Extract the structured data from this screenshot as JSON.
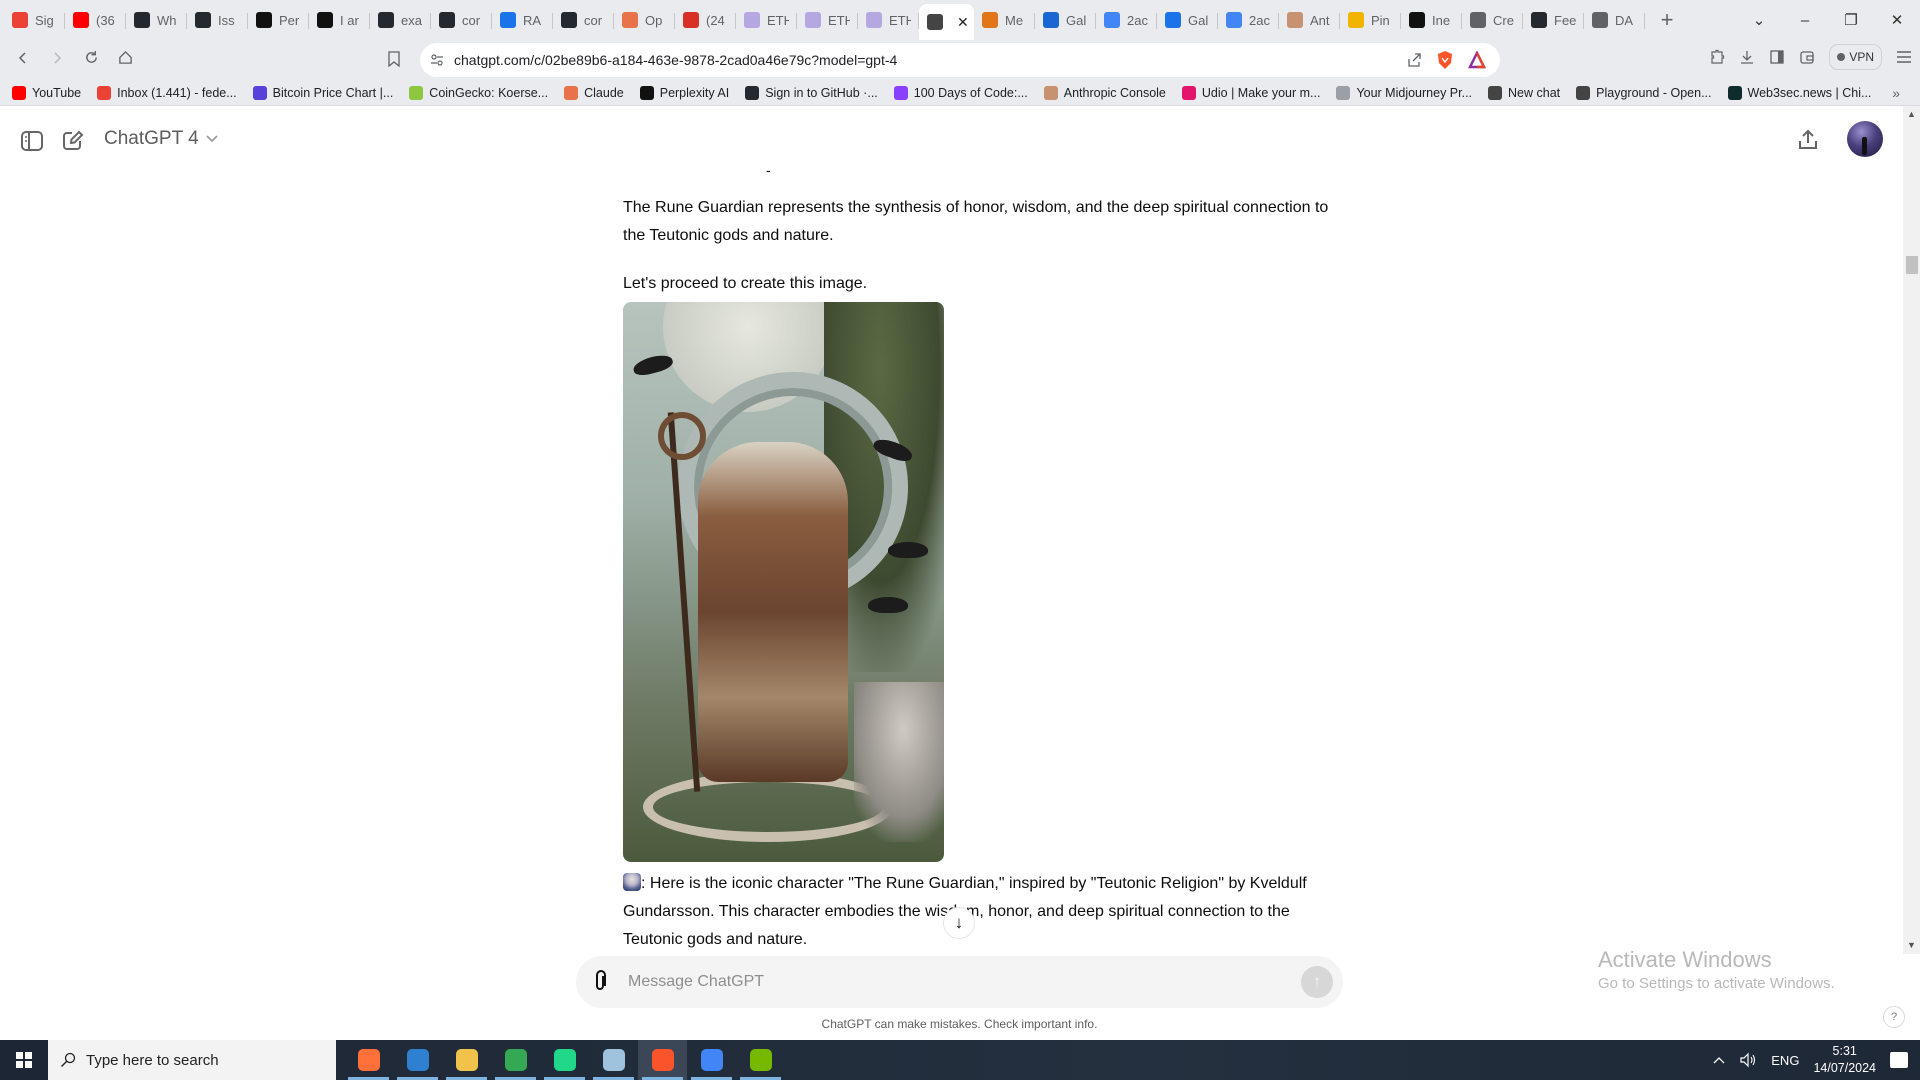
{
  "browser": {
    "tabs": [
      {
        "label": "Sig",
        "icon": "gmail-icon",
        "color": "#ea4335"
      },
      {
        "label": "(36",
        "icon": "youtube-icon",
        "color": "#ff0000"
      },
      {
        "label": "Wh",
        "icon": "github-icon",
        "color": "#24292f"
      },
      {
        "label": "Iss",
        "icon": "github-icon",
        "color": "#24292f"
      },
      {
        "label": "Per",
        "icon": "perplexity-icon",
        "color": "#111111"
      },
      {
        "label": "I ar",
        "icon": "perplexity-icon",
        "color": "#111111"
      },
      {
        "label": "exa",
        "icon": "github-icon",
        "color": "#24292f"
      },
      {
        "label": "cor",
        "icon": "github-icon",
        "color": "#24292f"
      },
      {
        "label": "RA",
        "icon": "blue-square-icon",
        "color": "#1a73e8"
      },
      {
        "label": "cor",
        "icon": "github-icon",
        "color": "#24292f"
      },
      {
        "label": "Op",
        "icon": "asterisk-icon",
        "color": "#e8734a"
      },
      {
        "label": "(24",
        "icon": "badge-2k-icon",
        "color": "#d93025"
      },
      {
        "label": "ETH",
        "icon": "eth-icon",
        "color": "#b5a7e0"
      },
      {
        "label": "ETH",
        "icon": "eth-icon",
        "color": "#b5a7e0"
      },
      {
        "label": "ETH",
        "icon": "eth-icon",
        "color": "#b5a7e0"
      },
      {
        "label": "",
        "icon": "openai-icon",
        "color": "#444444",
        "active": true,
        "close": "✕"
      },
      {
        "label": "Me",
        "icon": "metamask-icon",
        "color": "#e2761b"
      },
      {
        "label": "Gal",
        "icon": "download-square-icon",
        "color": "#1967d2"
      },
      {
        "label": "2ac",
        "icon": "hexagon-icon",
        "color": "#4285f4"
      },
      {
        "label": "Gal",
        "icon": "blue-square-icon",
        "color": "#1a73e8"
      },
      {
        "label": "2ac",
        "icon": "hexagon-icon",
        "color": "#4285f4"
      },
      {
        "label": "Ant",
        "icon": "anthropic-icon",
        "color": "#c69270"
      },
      {
        "label": "Pin",
        "icon": "pinata-icon",
        "color": "#f2b400"
      },
      {
        "label": "Ine",
        "icon": "perplexity-icon",
        "color": "#111111"
      },
      {
        "label": "Cre",
        "icon": "globe-icon",
        "color": "#5f6368"
      },
      {
        "label": "Fee",
        "icon": "github-icon",
        "color": "#24292f"
      },
      {
        "label": "DA",
        "icon": "globe-icon",
        "color": "#5f6368"
      }
    ],
    "new_tab": "+",
    "window_controls": {
      "tab_search": "⌄",
      "minimize": "–",
      "restore": "❐",
      "close": "✕"
    },
    "url": "chatgpt.com/c/02be89b6-a184-463e-9878-2cad0a46e79c?model=gpt-4",
    "vpn_label": "VPN",
    "bookmarks": [
      {
        "label": "YouTube",
        "icon": "youtube-icon",
        "color": "#ff0000"
      },
      {
        "label": "Inbox (1.441) - fede...",
        "icon": "gmail-icon",
        "color": "#ea4335"
      },
      {
        "label": "Bitcoin Price Chart |...",
        "icon": "kraken-icon",
        "color": "#5741d9"
      },
      {
        "label": "CoinGecko: Koerse...",
        "icon": "coingecko-icon",
        "color": "#8dc63f"
      },
      {
        "label": "Claude",
        "icon": "claude-icon",
        "color": "#e8734a"
      },
      {
        "label": "Perplexity AI",
        "icon": "perplexity-icon",
        "color": "#111111"
      },
      {
        "label": "Sign in to GitHub ·...",
        "icon": "github-icon",
        "color": "#24292f"
      },
      {
        "label": "100 Days of Code:...",
        "icon": "replit-icon",
        "color": "#8a3ffc"
      },
      {
        "label": "Anthropic Console",
        "icon": "anthropic-icon",
        "color": "#c69270"
      },
      {
        "label": "Udio | Make your m...",
        "icon": "udio-icon",
        "color": "#e2156b"
      },
      {
        "label": "Your Midjourney Pr...",
        "icon": "midjourney-icon",
        "color": "#9aa0a6"
      },
      {
        "label": "New chat",
        "icon": "openai-icon",
        "color": "#444444"
      },
      {
        "label": "Playground - Open...",
        "icon": "openai-icon",
        "color": "#444444"
      },
      {
        "label": "Web3sec.news | Chi...",
        "icon": "terminal-icon",
        "color": "#0f2b2b"
      }
    ],
    "bookmarks_more": "»"
  },
  "chat": {
    "model_name": "ChatGPT 4",
    "dash": "-",
    "paragraph_1": "The Rune Guardian represents the synthesis of honor, wisdom, and the deep spiritual connection to the Teutonic gods and nature.",
    "paragraph_2": "Let's proceed to create this image.",
    "image_alt": "Generated image: The Rune Guardian — a bearded Norse sage with a runic staff, ravens and a wolf, before a circle of runes under a full moon",
    "paragraph_3": ": Here is the iconic character \"The Rune Guardian,\" inspired by \"Teutonic Religion\" by Kveldulf Gundarsson. This character embodies the wisdom, honor, and deep spiritual connection to the Teutonic gods and nature.",
    "input_placeholder": "Message ChatGPT",
    "disclaimer": "ChatGPT can make mistakes. Check important info.",
    "scroll_down": "↓",
    "send": "↑"
  },
  "watermark": {
    "title": "Activate Windows",
    "subtitle": "Go to Settings to activate Windows."
  },
  "help": "?",
  "taskbar": {
    "search_placeholder": "Type here to search",
    "apps": [
      {
        "name": "firefox",
        "color": "#ff7139"
      },
      {
        "name": "vscode",
        "color": "#2f80d1"
      },
      {
        "name": "file-explorer",
        "color": "#f2c34c"
      },
      {
        "name": "chrome",
        "color": "#34a853"
      },
      {
        "name": "pycharm",
        "color": "#21d789"
      },
      {
        "name": "notepad",
        "color": "#9fc3dd"
      },
      {
        "name": "brave",
        "color": "#fb542b",
        "active": true
      },
      {
        "name": "chrome-profile",
        "color": "#4285f4"
      },
      {
        "name": "nvidia",
        "color": "#76b900"
      }
    ],
    "language": "ENG",
    "time": "5:31",
    "date": "14/07/2024"
  }
}
